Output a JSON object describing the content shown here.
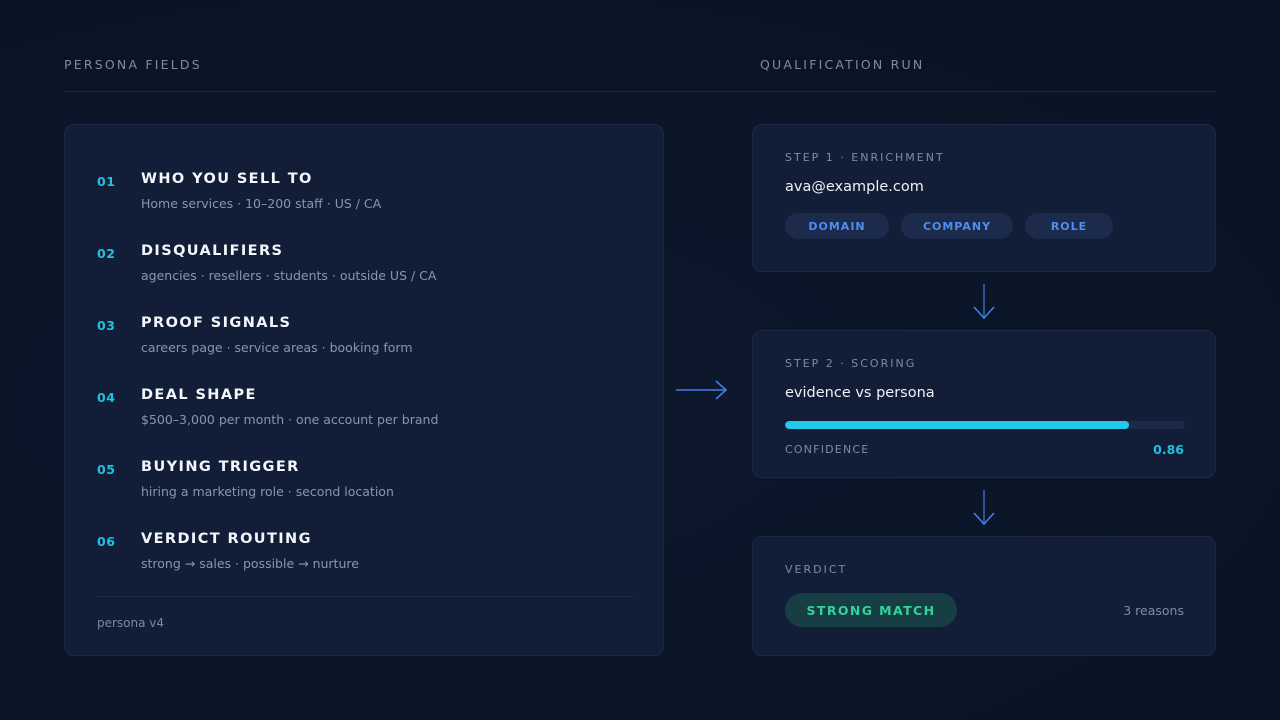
{
  "headers": {
    "left": "PERSONA FIELDS",
    "right": "QUALIFICATION RUN"
  },
  "persona": {
    "fields": [
      {
        "num": "01",
        "title": "WHO YOU SELL TO",
        "desc": "Home services · 10–200 staff · US / CA"
      },
      {
        "num": "02",
        "title": "DISQUALIFIERS",
        "desc": "agencies · resellers · students · outside US / CA"
      },
      {
        "num": "03",
        "title": "PROOF SIGNALS",
        "desc": "careers page · service areas · booking form"
      },
      {
        "num": "04",
        "title": "DEAL SHAPE",
        "desc": "$500–3,000 per month · one account per brand"
      },
      {
        "num": "05",
        "title": "BUYING TRIGGER",
        "desc": "hiring a marketing role · second location"
      },
      {
        "num": "06",
        "title": "VERDICT ROUTING",
        "desc": "strong → sales · possible → nurture"
      }
    ],
    "version": "persona v4"
  },
  "run": {
    "step1": {
      "label": "STEP 1 · ENRICHMENT",
      "email": "ava@example.com",
      "chips": [
        "DOMAIN",
        "COMPANY",
        "ROLE"
      ]
    },
    "step2": {
      "label": "STEP 2 · SCORING",
      "text": "evidence vs persona",
      "confidence_label": "CONFIDENCE",
      "confidence_value": "0.86",
      "confidence_fraction": 0.86
    },
    "verdict": {
      "label": "VERDICT",
      "badge": "STRONG MATCH",
      "reasons": "3 reasons"
    }
  },
  "colors": {
    "accent_cyan": "#22c1e4",
    "accent_blue": "#4f8ef0",
    "match_green": "#34d39a",
    "panel_bg": "#121e37"
  },
  "icons": {
    "flow_arrow_right": "arrow-right-icon",
    "flow_arrow_down": "arrow-down-icon"
  }
}
